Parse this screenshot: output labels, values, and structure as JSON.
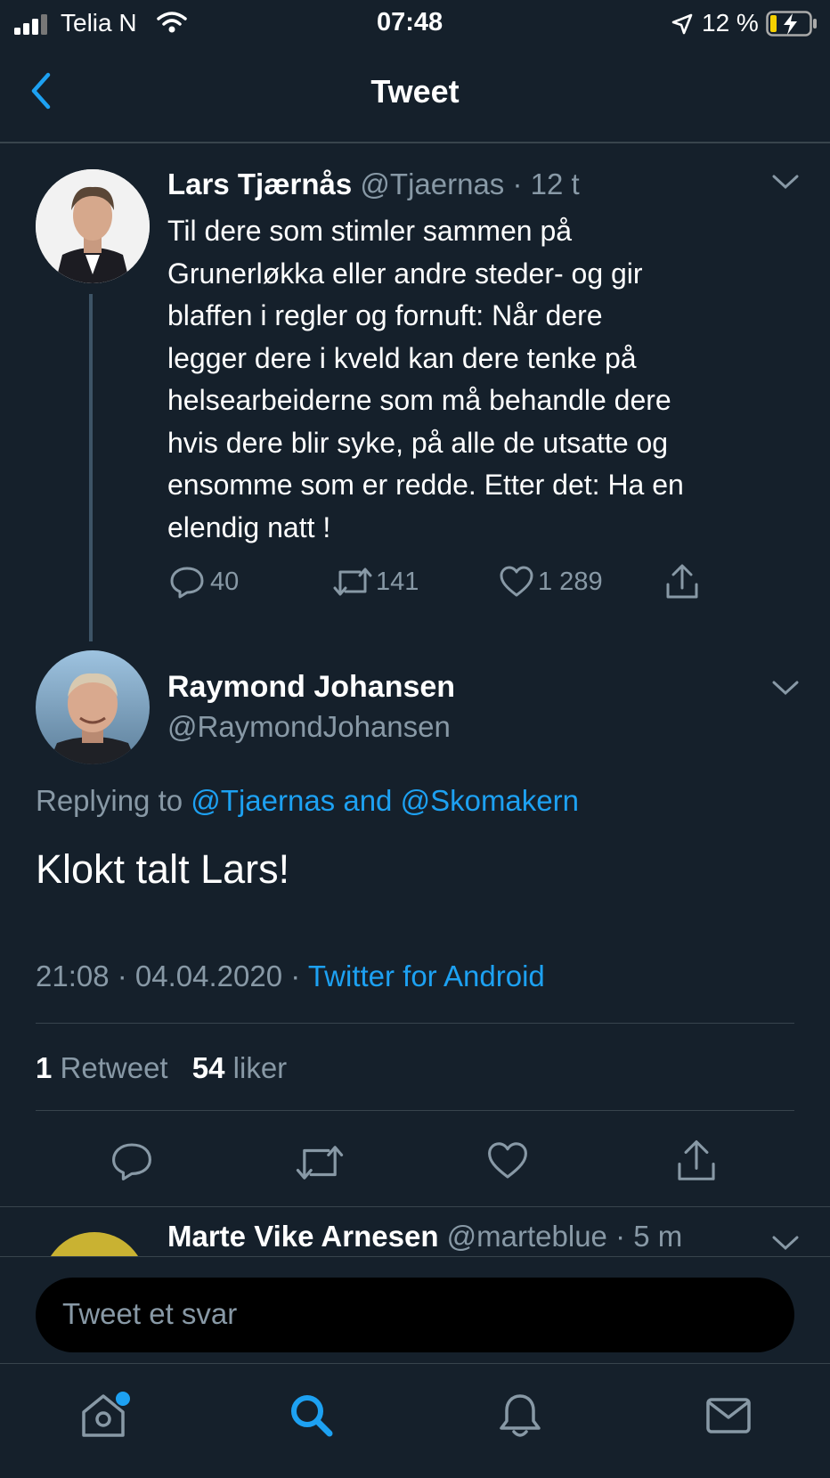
{
  "status_bar": {
    "carrier": "Telia N",
    "time": "07:48",
    "battery": "12 %"
  },
  "header": {
    "title": "Tweet",
    "back_icon": "chevron-left-icon"
  },
  "parent_tweet": {
    "name": "Lars Tjærnås",
    "handle": "@Tjaernas",
    "sep": "·",
    "age": "12 t",
    "lines": [
      "Til dere som stimler sammen på",
      "Grunerløkka eller andre steder- og gir",
      "blaffen i regler og fornuft: Når dere",
      "legger dere i kveld kan dere tenke på",
      "helsearbeiderne som må behandle dere",
      "hvis dere blir syke, på alle de utsatte og",
      "ensomme som er redde. Etter det: Ha en",
      "elendig natt !"
    ],
    "replies": "40",
    "retweets": "141",
    "likes": "1 289"
  },
  "main_tweet": {
    "name": "Raymond Johansen",
    "handle": "@RaymondJohansen",
    "replying_prefix": "Replying to",
    "replying_user1": "@Tjaernas",
    "replying_and": "and",
    "replying_user2": "@Skomakern",
    "text": "Klokt talt Lars!",
    "timestamp": "21:08 · 04.04.2020 ·",
    "source": "Twitter for Android",
    "retweet_count": "1",
    "retweet_label": "Retweet",
    "like_count": "54",
    "like_label": "liker"
  },
  "next_tweet": {
    "name": "Marte Vike Arnesen",
    "handle": "@marteblue",
    "sep": "·",
    "age": "5 m"
  },
  "reply_box": {
    "placeholder": "Tweet et svar"
  },
  "tab_bar": [
    "home-icon",
    "search-icon",
    "notifications-icon",
    "messages-icon"
  ],
  "colors": {
    "background": "#15202b",
    "accent": "#1da1f2",
    "muted": "#8899a6",
    "divider": "#38444d"
  }
}
